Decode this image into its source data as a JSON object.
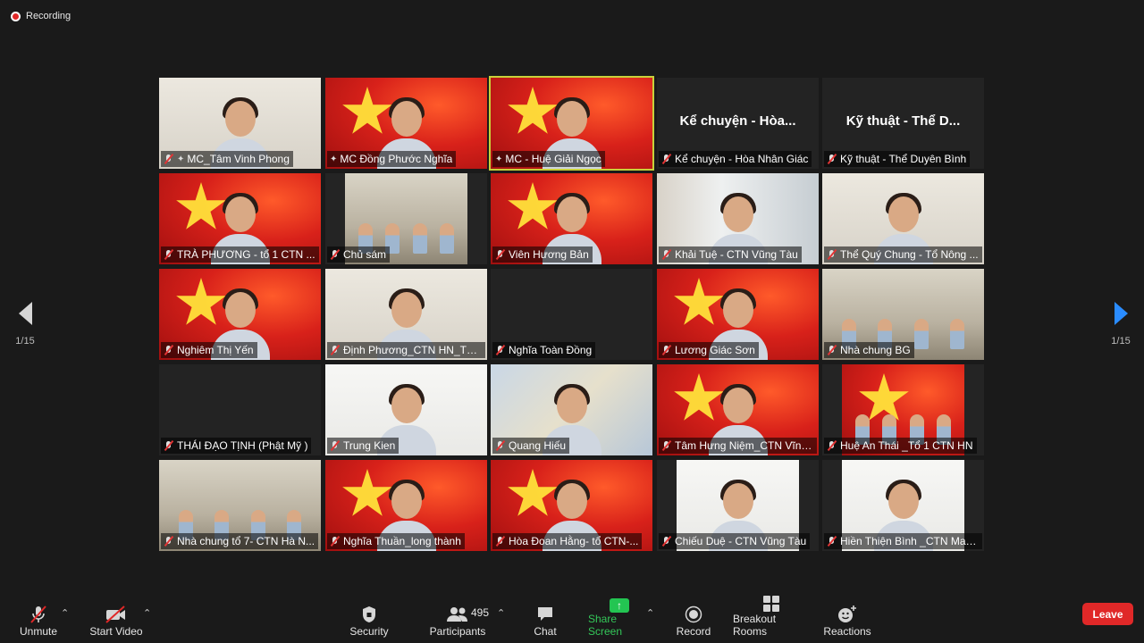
{
  "recording": "Recording",
  "pagination": {
    "left": "1/15",
    "right": "1/15"
  },
  "tiles": [
    {
      "name": "MC_Tâm Vinh Phong",
      "bg": "wall",
      "muted": true,
      "pinned": true,
      "kind": "person"
    },
    {
      "name": "MC Đồng Phước Nghĩa",
      "bg": "flag",
      "muted": false,
      "pinned": true,
      "kind": "person"
    },
    {
      "name": "MC - Huệ Giải Ngọc",
      "bg": "flag",
      "muted": false,
      "pinned": true,
      "kind": "person",
      "active": true
    },
    {
      "name": "Kể chuyện - Hòa Nhân Giác",
      "bg": "dark",
      "muted": true,
      "kind": "name",
      "display": "Kể chuyện - Hòa..."
    },
    {
      "name": "Kỹ thuật - Thể Duyên Bình",
      "bg": "dark",
      "muted": true,
      "kind": "name",
      "display": "Kỹ thuật - Thể D..."
    },
    {
      "name": "TRÀ PHƯƠNG - tổ 1 CTN ...",
      "bg": "flag",
      "muted": true,
      "kind": "person"
    },
    {
      "name": "Chủ sám",
      "bg": "room",
      "muted": true,
      "kind": "group",
      "narrow": true
    },
    {
      "name": "Viên Hương Bản",
      "bg": "flag",
      "muted": true,
      "kind": "person"
    },
    {
      "name": "Khải Tuệ - CTN Vũng Tàu",
      "bg": "curtain",
      "muted": true,
      "kind": "person"
    },
    {
      "name": "Thể Quý Chung - Tổ Nông ...",
      "bg": "wall",
      "muted": true,
      "kind": "person"
    },
    {
      "name": "Nghiêm Thị Yến",
      "bg": "flag",
      "muted": true,
      "kind": "person"
    },
    {
      "name": "Định Phương_CTN HN_Tổ ...",
      "bg": "wall",
      "muted": true,
      "kind": "person"
    },
    {
      "name": "Nghĩa Toàn Đồng",
      "bg": "dark",
      "muted": true,
      "kind": "empty"
    },
    {
      "name": "Lương Giác Sơn",
      "bg": "flag",
      "muted": true,
      "kind": "person"
    },
    {
      "name": "Nhà chung BG",
      "bg": "room",
      "muted": true,
      "kind": "group"
    },
    {
      "name": "THÁI ĐẠO TỊNH (Phật Mỹ )",
      "bg": "dark",
      "muted": true,
      "kind": "empty"
    },
    {
      "name": "Trung Kien",
      "bg": "white",
      "muted": true,
      "kind": "person"
    },
    {
      "name": "Quang Hiếu",
      "bg": "map",
      "muted": true,
      "kind": "person"
    },
    {
      "name": "Tâm Hưng Niệm_CTN Vĩnh ...",
      "bg": "flag",
      "muted": true,
      "kind": "person"
    },
    {
      "name": "Huệ An Thái _Tổ 1 CTN HN",
      "bg": "flag",
      "muted": true,
      "kind": "group",
      "narrow": true
    },
    {
      "name": "Nhà chung tổ 7- CTN Hà N...",
      "bg": "room",
      "muted": true,
      "kind": "group"
    },
    {
      "name": "Nghĩa Thuần_long thành",
      "bg": "flag",
      "muted": true,
      "kind": "person"
    },
    {
      "name": "Hòa Đoan Hằng- tổ CTN-...",
      "bg": "flag",
      "muted": true,
      "kind": "person"
    },
    {
      "name": "Chiếu Duệ - CTN Vũng Tàu",
      "bg": "white",
      "muted": true,
      "kind": "person",
      "narrow": true
    },
    {
      "name": "Hiền Thiện Bình _CTN Mala...",
      "bg": "white",
      "muted": true,
      "kind": "person",
      "narrow": true
    }
  ],
  "toolbar": {
    "unmute": "Unmute",
    "start_video": "Start Video",
    "security": "Security",
    "participants": "Participants",
    "participants_count": "495",
    "chat": "Chat",
    "share_screen": "Share Screen",
    "record": "Record",
    "breakout_rooms": "Breakout Rooms",
    "reactions": "Reactions",
    "leave": "Leave"
  },
  "colors": {
    "accent_green": "#23c552",
    "leave_red": "#e02828",
    "active_outline": "#c8d13a",
    "nav_blue": "#2a8cff"
  }
}
